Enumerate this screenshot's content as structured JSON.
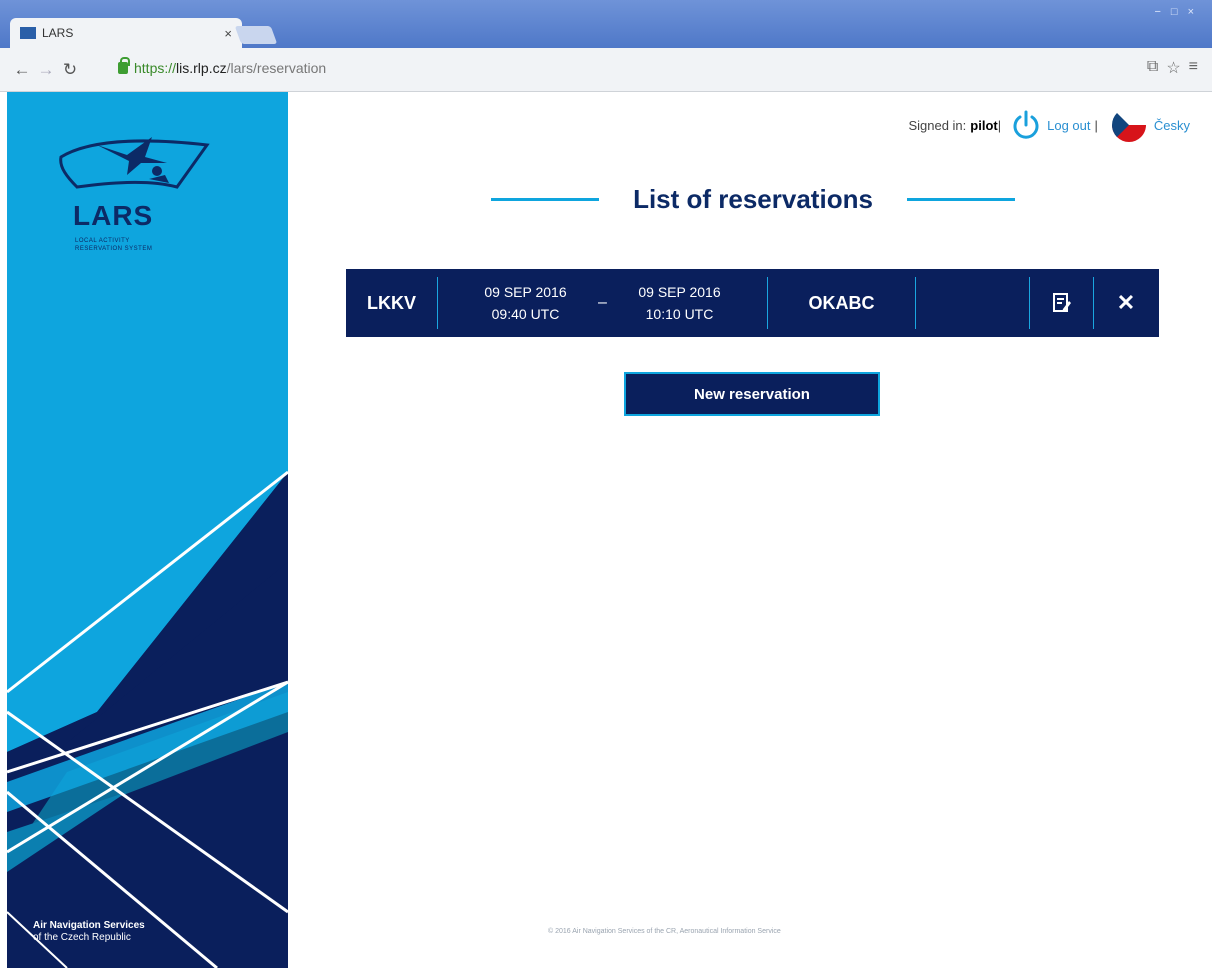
{
  "browser": {
    "tab_title": "LARS",
    "tab_close": "×",
    "url_scheme": "https://",
    "url_host": "lis.rlp.cz",
    "url_path": "/lars/reservation",
    "window_controls": [
      "−",
      "□",
      "×"
    ]
  },
  "header": {
    "signed_in_label": "Signed in:",
    "user": "pilot",
    "separator1": "|",
    "logout_label": "Log out",
    "separator2": "|",
    "language_label": "Česky"
  },
  "sidebar": {
    "logo_title": "LARS",
    "logo_subtitle_1": "LOCAL ACTIVITY",
    "logo_subtitle_2": "RESERVATION SYSTEM",
    "org_line1": "Air Navigation Services",
    "org_line2": "of the Czech Republic"
  },
  "main": {
    "title": "List of reservations",
    "reservations": [
      {
        "airport": "LKKV",
        "from_date": "09 SEP 2016",
        "from_time": "09:40 UTC",
        "separator": "–",
        "to_date": "09 SEP 2016",
        "to_time": "10:10 UTC",
        "registration": "OKABC",
        "note": "",
        "delete_label": "✕"
      }
    ],
    "new_button": "New reservation"
  },
  "footer": {
    "text": "© 2016 Air Navigation Services of the CR, Aeronautical Information Service"
  },
  "colors": {
    "navy": "#0a1f5c",
    "cyan": "#0ea5de",
    "link": "#2a8fd1"
  }
}
